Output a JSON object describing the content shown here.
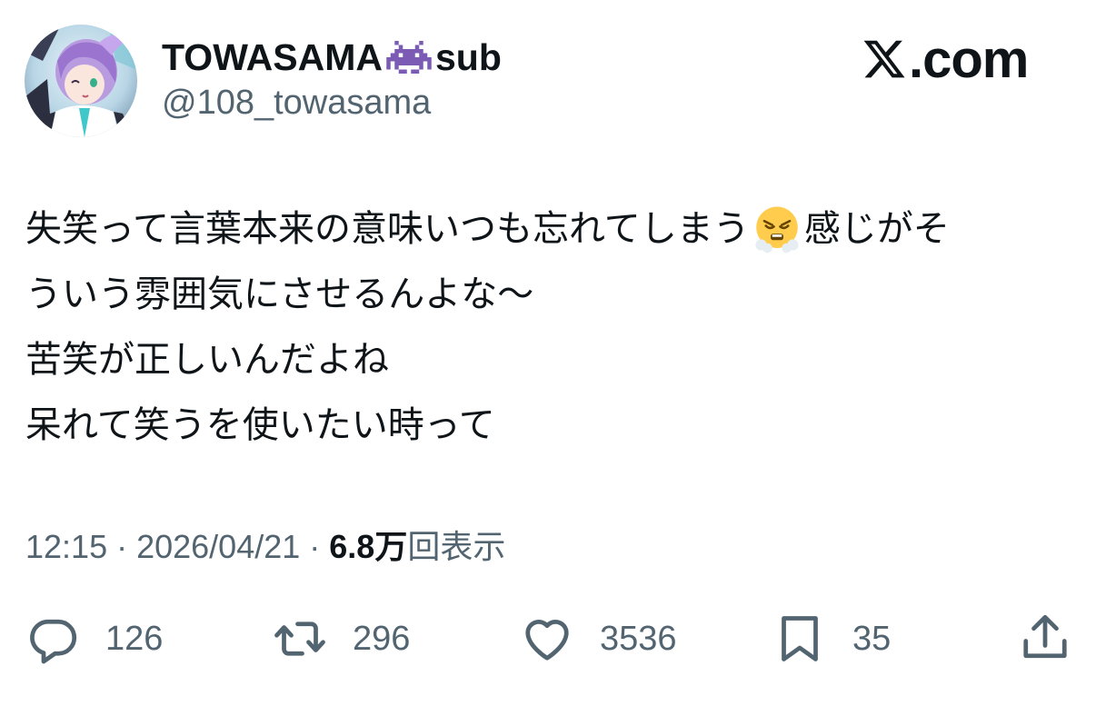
{
  "author": {
    "display_name": "TOWASAMA",
    "name_emoji": "alien-monster-emoji",
    "name_suffix": "sub",
    "handle": "@108_towasama",
    "avatar": "avatar-image"
  },
  "brand": {
    "label": ".com",
    "logo": "x-logo-icon"
  },
  "tweet": {
    "line1_part1": "失笑って言葉本来の意味いつも忘れてしまう",
    "line1_emoji": "face-with-steam-from-nose-emoji",
    "line1_part2": "感じがそ",
    "line2": "ういう雰囲気にさせるんよな〜",
    "line3": "苦笑が正しいんだよね",
    "line4": "呆れて笑うを使いたい時って"
  },
  "meta": {
    "time": "12:15",
    "separator": "·",
    "date": "2026/04/21",
    "views_count": "6.8万",
    "views_label": "回表示"
  },
  "actions": {
    "reply_count": "126",
    "retweet_count": "296",
    "like_count": "3536",
    "bookmark_count": "35"
  },
  "colors": {
    "text_primary": "#0f1419",
    "text_secondary": "#536471",
    "background": "#ffffff",
    "invader_purple": "#7c5bb5"
  }
}
